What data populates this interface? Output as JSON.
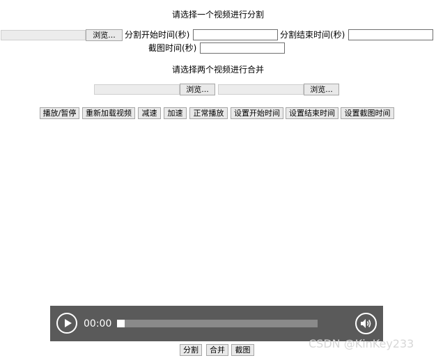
{
  "split_section": {
    "title": "请选择一个视频进行分割",
    "browse_label": "浏览...",
    "start_label": "分割开始时间(秒)",
    "end_label": "分割结束时间(秒)",
    "screenshot_label": "截图时间(秒)",
    "start_value": "",
    "end_value": "",
    "screenshot_value": ""
  },
  "merge_section": {
    "title": "请选择两个视频进行合并",
    "browse1_label": "浏览...",
    "browse2_label": "浏览..."
  },
  "controls": {
    "play_pause": "播放/暂停",
    "reload": "重新加载视频",
    "slow_down": "减速",
    "speed_up": "加速",
    "normal_speed": "正常播放",
    "set_start": "设置开始时间",
    "set_end": "设置结束时间",
    "set_screenshot": "设置截图时间"
  },
  "player": {
    "time": "00:00",
    "progress": 0,
    "play_icon": "play-icon",
    "volume_icon": "volume-icon"
  },
  "actions": {
    "split": "分割",
    "merge": "合并",
    "screenshot": "截图"
  },
  "watermark": "CSDN @KinKey233"
}
